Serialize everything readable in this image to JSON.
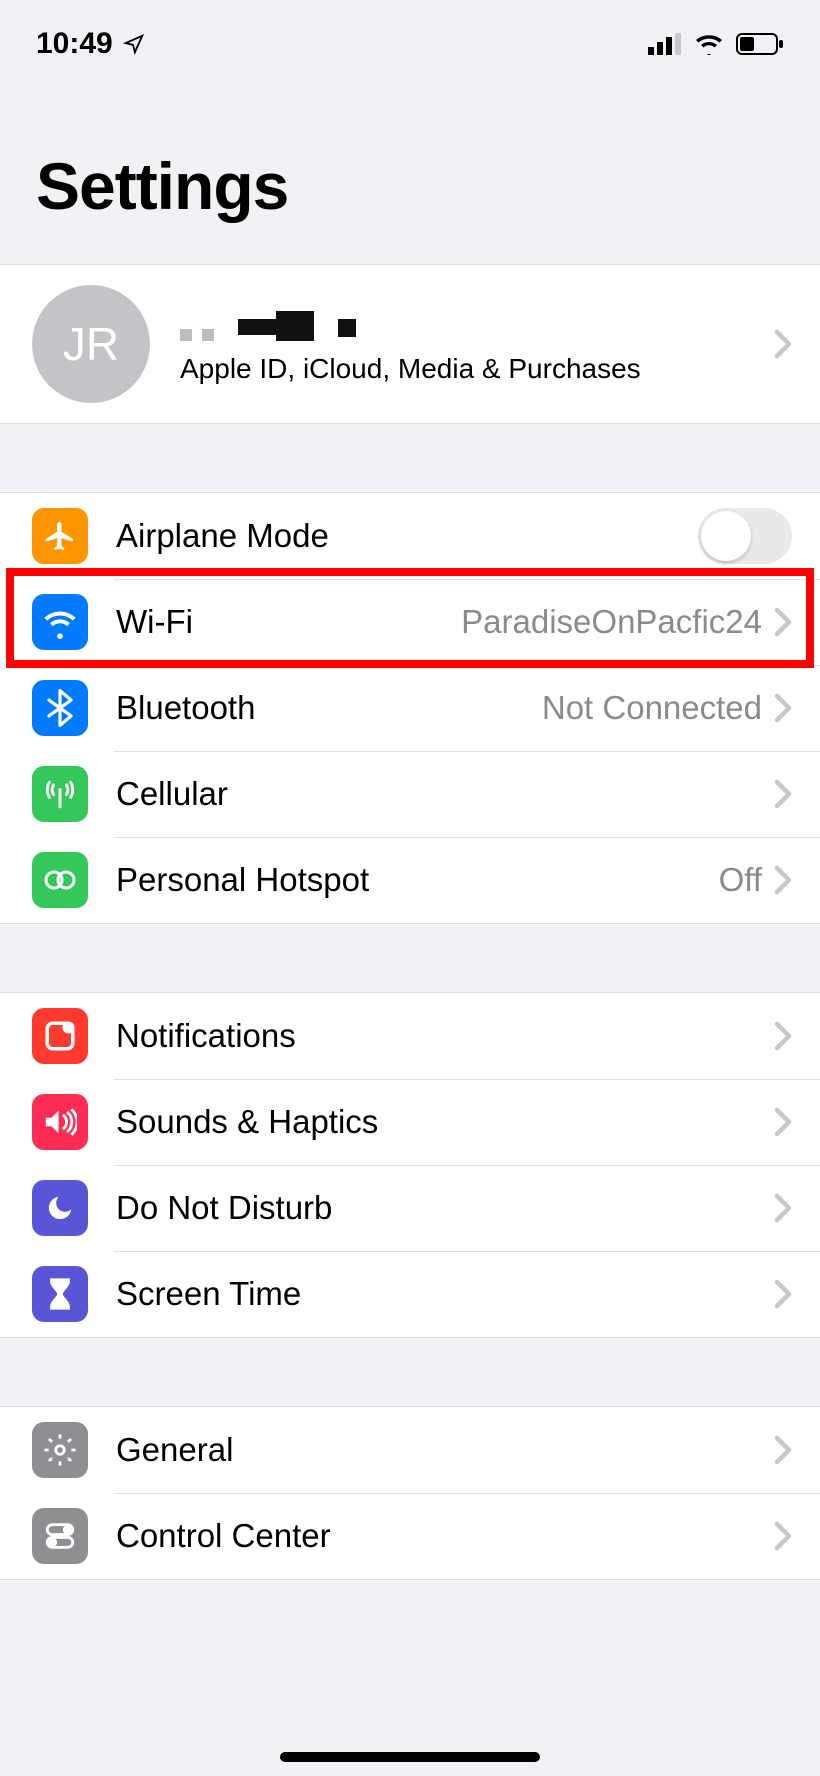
{
  "status": {
    "time": "10:49"
  },
  "page": {
    "title": "Settings"
  },
  "apple_id": {
    "initials": "JR",
    "subtitle": "Apple ID, iCloud, Media & Purchases"
  },
  "rows": {
    "airplane": {
      "label": "Airplane Mode"
    },
    "wifi": {
      "label": "Wi-Fi",
      "value": "ParadiseOnPacfic24"
    },
    "bluetooth": {
      "label": "Bluetooth",
      "value": "Not Connected"
    },
    "cellular": {
      "label": "Cellular"
    },
    "hotspot": {
      "label": "Personal Hotspot",
      "value": "Off"
    },
    "notifications": {
      "label": "Notifications"
    },
    "sounds": {
      "label": "Sounds & Haptics"
    },
    "dnd": {
      "label": "Do Not Disturb"
    },
    "screentime": {
      "label": "Screen Time"
    },
    "general": {
      "label": "General"
    },
    "controlcenter": {
      "label": "Control Center"
    }
  }
}
